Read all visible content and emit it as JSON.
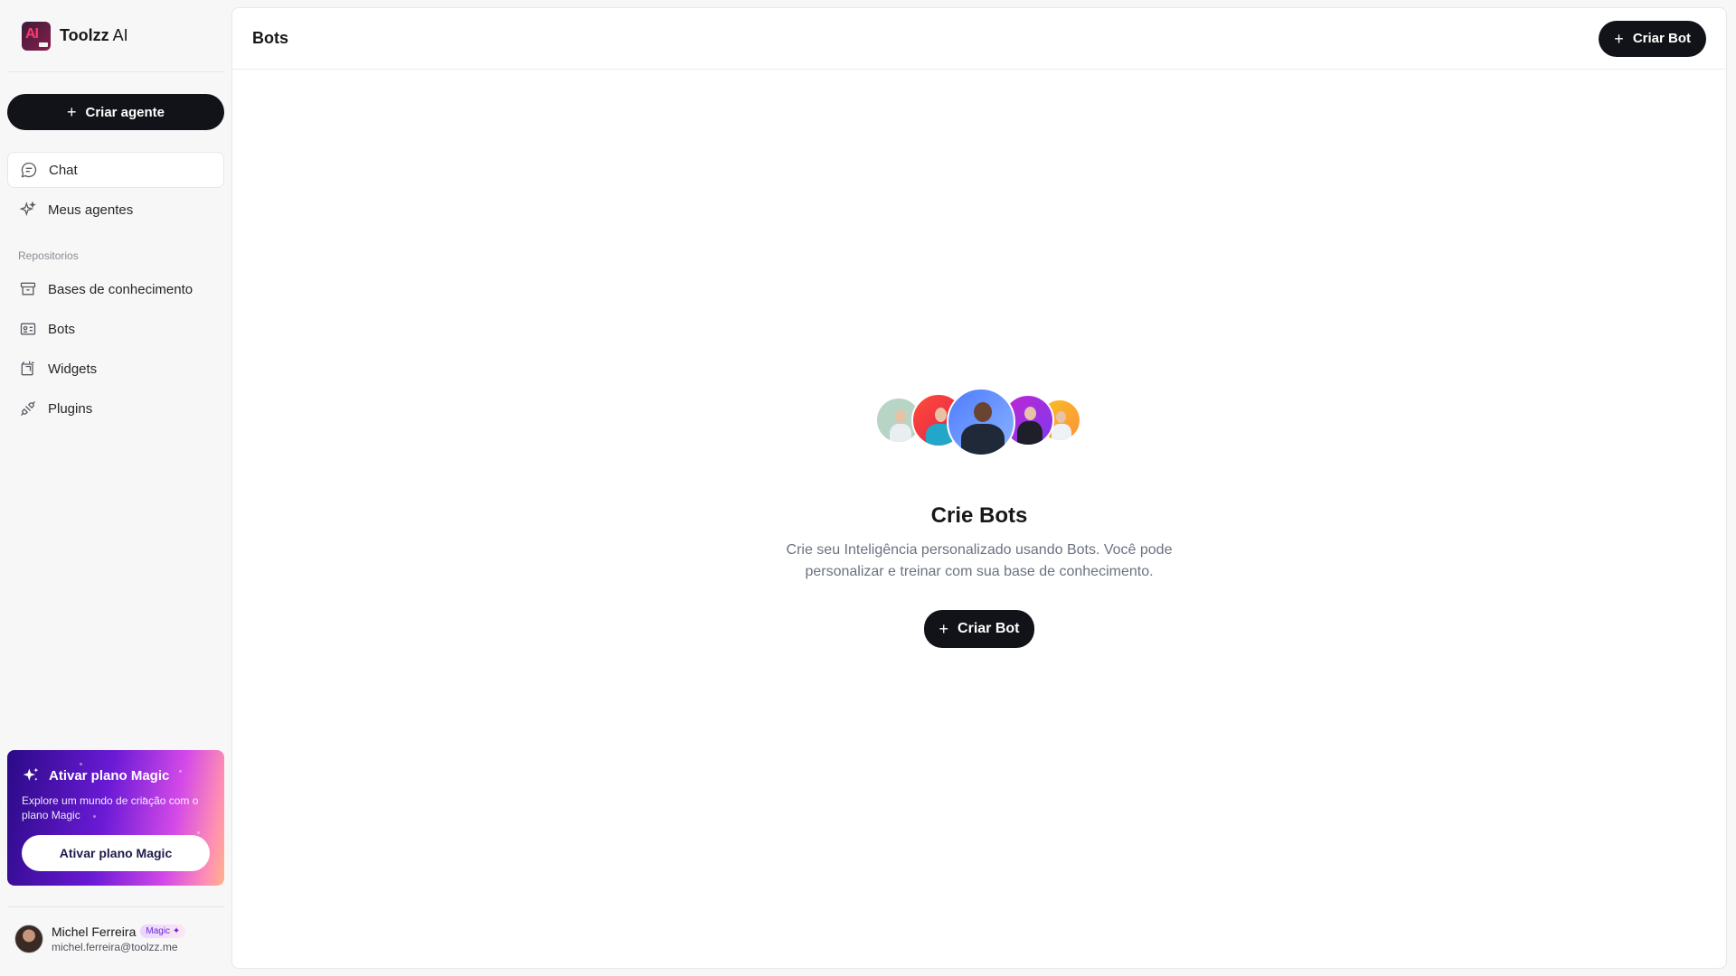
{
  "app": {
    "brand": "Toolzz",
    "brand_suffix": "AI",
    "logo_text": "AI"
  },
  "sidebar": {
    "create_label": "Criar agente",
    "items": [
      {
        "label": "Chat",
        "icon": "chat-icon",
        "active": true
      },
      {
        "label": "Meus agentes",
        "icon": "sparkle-icon",
        "active": false
      }
    ],
    "section_label": "Repositorios",
    "repo_items": [
      {
        "label": "Bases de conhecimento",
        "icon": "archive-icon"
      },
      {
        "label": "Bots",
        "icon": "id-card-icon"
      },
      {
        "label": "Widgets",
        "icon": "widget-icon"
      },
      {
        "label": "Plugins",
        "icon": "plug-icon"
      }
    ]
  },
  "promo": {
    "title": "Ativar plano Magic",
    "text": "Explore um mundo de criação com o plano Magic",
    "button": "Ativar plano Magic"
  },
  "user": {
    "name": "Michel Ferreira",
    "badge": "Magic ✦",
    "email": "michel.ferreira@toolzz.me"
  },
  "header": {
    "title": "Bots",
    "create_label": "Criar Bot"
  },
  "empty_state": {
    "title": "Crie Bots",
    "text": "Crie seu Inteligência personalizado usando Bots. Você pode personalizar e treinar com sua base de conhecimento.",
    "button": "Criar Bot"
  },
  "colors": {
    "primary": "#111318",
    "sidebar_bg": "#f7f7f8",
    "promo_start": "#2a0a86",
    "promo_end": "#ffb38a"
  }
}
